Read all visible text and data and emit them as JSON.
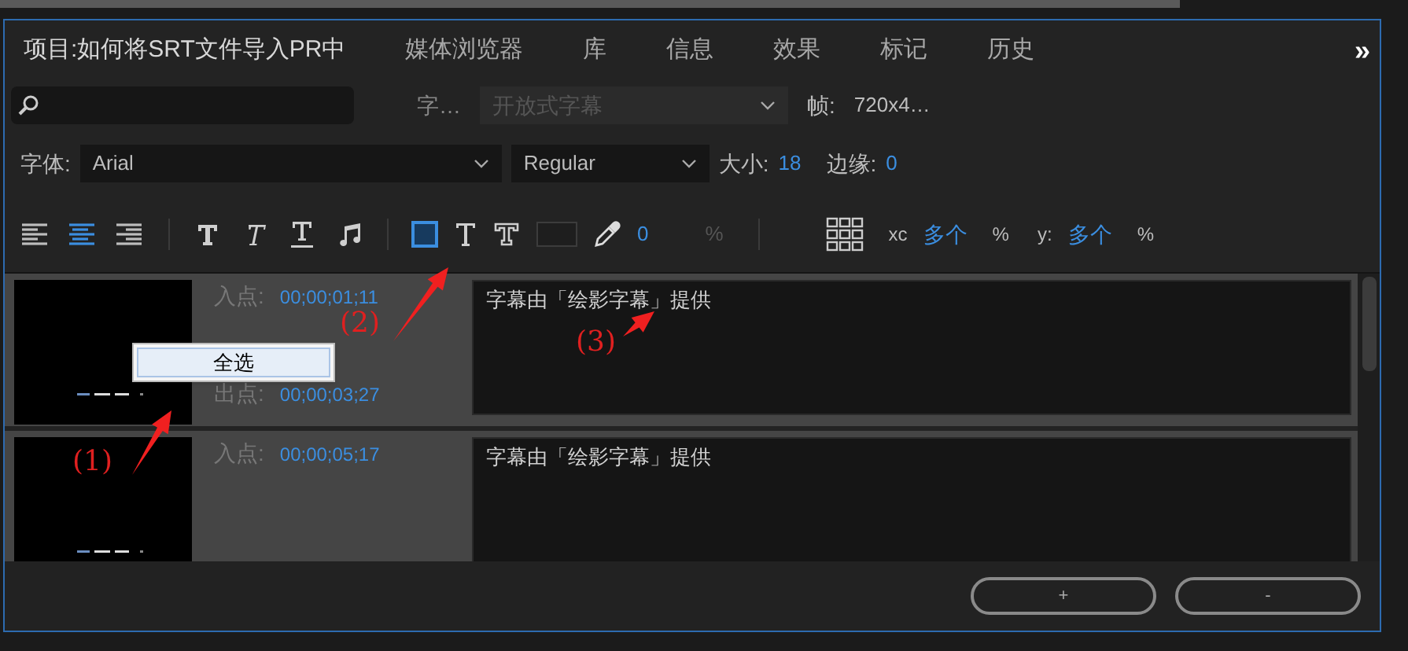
{
  "tabs": [
    {
      "label": "项目:如何将SRT文件导入PR中",
      "selected": true
    },
    {
      "label": "媒体浏览器",
      "selected": false
    },
    {
      "label": "库",
      "selected": false
    },
    {
      "label": "信息",
      "selected": false
    },
    {
      "label": "效果",
      "selected": false
    },
    {
      "label": "标记",
      "selected": false
    },
    {
      "label": "历史",
      "selected": false
    }
  ],
  "more_tabs": "»",
  "filter_row": {
    "stream_label": "字…",
    "stream_value": "开放式字幕",
    "stream_disabled": true,
    "frame_label": "帧:",
    "frame_value": "720x4…"
  },
  "font_row": {
    "font_label": "字体:",
    "font": "Arial",
    "style": "Regular",
    "size_label": "大小:",
    "size": "18",
    "edge_label": "边缘:",
    "edge": "0"
  },
  "align_buttons": [
    {
      "kind": "left",
      "selected": false
    },
    {
      "kind": "center",
      "selected": true
    },
    {
      "kind": "right",
      "selected": false
    }
  ],
  "style_buttons": [
    {
      "kind": "bold"
    },
    {
      "kind": "italic"
    },
    {
      "kind": "underline"
    },
    {
      "kind": "music"
    }
  ],
  "color_buttons": [
    {
      "kind": "background",
      "selected": true
    },
    {
      "kind": "text",
      "selected": false
    },
    {
      "kind": "outline",
      "selected": false
    }
  ],
  "opacity": {
    "value": "0",
    "unit": "%"
  },
  "position": {
    "x_label": "xc",
    "x_value": "多个",
    "x_unit": "%",
    "y_label": "y:",
    "y_value": "多个",
    "y_unit": "%"
  },
  "captions": [
    {
      "in_label": "入点:",
      "in_time": "00;00;01;11",
      "out_label": "出点:",
      "out_time": "00;00;03;27",
      "text": "字幕由「绘影字幕」提供"
    },
    {
      "in_label": "入点:",
      "in_time": "00;00;05;17",
      "text": "字幕由「绘影字幕」提供"
    }
  ],
  "context_menu": {
    "item": "全选"
  },
  "buttons": [
    "+",
    "-"
  ],
  "annotations": [
    {
      "label": "(1)"
    },
    {
      "label": "(2)"
    },
    {
      "label": "(3)"
    }
  ]
}
